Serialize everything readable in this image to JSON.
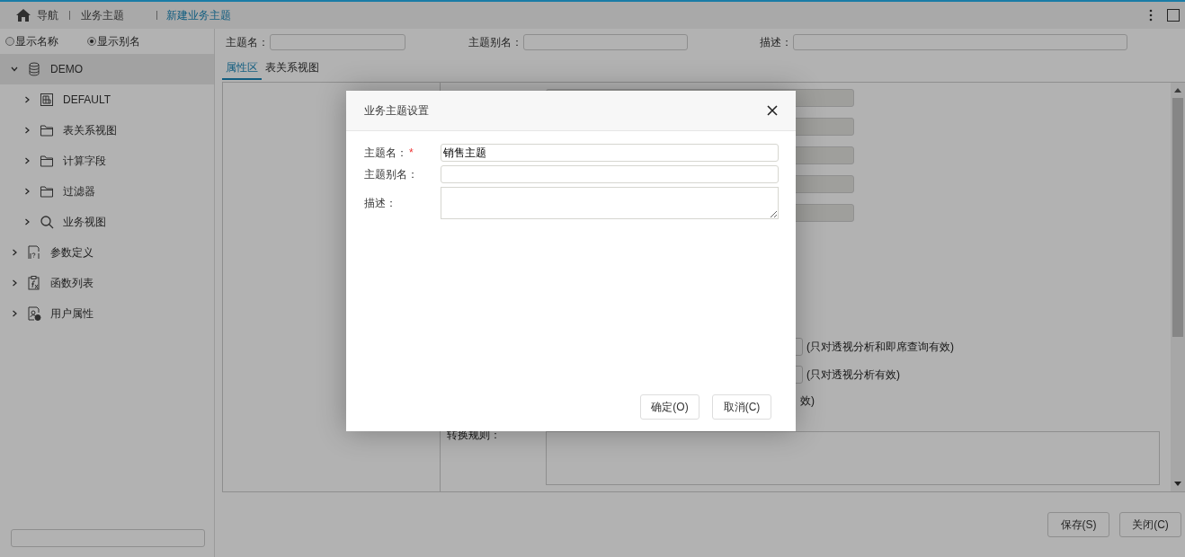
{
  "header": {
    "breadcrumbs": [
      {
        "label": "导航",
        "selected": false
      },
      {
        "label": "业务主题",
        "selected": false
      },
      {
        "label": "新建业务主题",
        "selected": true
      }
    ]
  },
  "sidebar": {
    "display_options": [
      {
        "label": "显示名称",
        "selected": false
      },
      {
        "label": "显示别名",
        "selected": true
      }
    ],
    "tree": [
      {
        "label": "DEMO",
        "kind": "database",
        "expanded": true,
        "selected": true,
        "children": [
          {
            "label": "DEFAULT",
            "kind": "table",
            "expanded": false,
            "selected": false
          },
          {
            "label": "表关系视图",
            "kind": "folder",
            "expanded": false,
            "selected": false
          },
          {
            "label": "计算字段",
            "kind": "folder",
            "expanded": false,
            "selected": false
          },
          {
            "label": "过滤器",
            "kind": "folder",
            "expanded": false,
            "selected": false
          },
          {
            "label": "业务视图",
            "kind": "search",
            "expanded": false,
            "selected": false
          }
        ]
      },
      {
        "label": "参数定义",
        "kind": "parameter",
        "expanded": false,
        "selected": false
      },
      {
        "label": "函数列表",
        "kind": "function",
        "expanded": false,
        "selected": false
      },
      {
        "label": "用户属性",
        "kind": "user",
        "expanded": false,
        "selected": false
      }
    ]
  },
  "form": {
    "fields": [
      {
        "label": "主题名："
      },
      {
        "label": "主题别名："
      },
      {
        "label": "描述："
      }
    ]
  },
  "tabs": [
    {
      "label": "属性区",
      "selected": true
    },
    {
      "label": "表关系视图",
      "selected": false
    }
  ],
  "properties": {
    "notes": [
      "(只对透视分析和即席查询有效)",
      "(只对透视分析有效)",
      "效)"
    ],
    "conversion_rule_label": "转换规则："
  },
  "footer_buttons": [
    "保存(S)",
    "关闭(C)"
  ],
  "dialog": {
    "title": "业务主题设置",
    "required_mark": "*",
    "fields": [
      {
        "label": "主题名：",
        "required": true,
        "kind": "input",
        "value": "销售主题"
      },
      {
        "label": "主题别名：",
        "required": false,
        "kind": "input"
      },
      {
        "label": "描述：",
        "required": false,
        "kind": "textarea"
      }
    ],
    "buttons": [
      "确定(O)",
      "取消(C)"
    ]
  }
}
